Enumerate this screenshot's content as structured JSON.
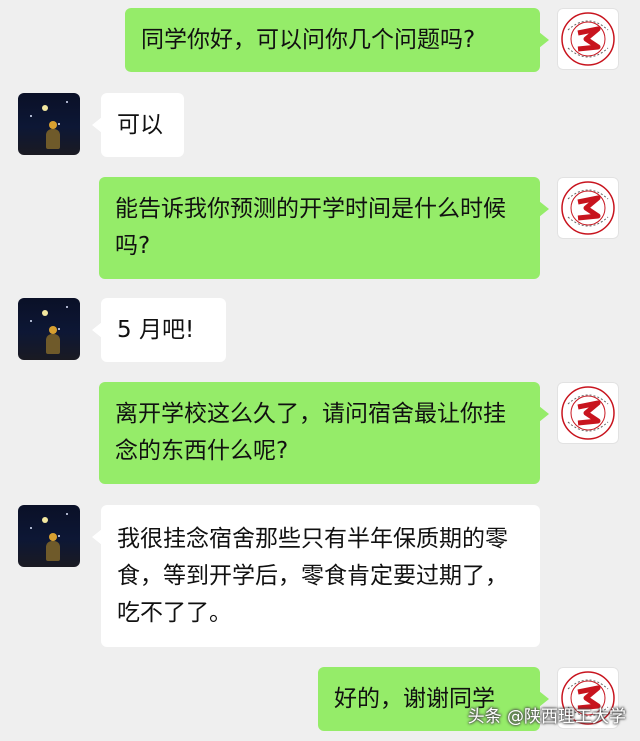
{
  "messages": [
    {
      "sender": "me",
      "text": "同学你好，可以问你几个问题吗?"
    },
    {
      "sender": "other",
      "text": "可以"
    },
    {
      "sender": "me",
      "text": "能告诉我你预测的开学时间是什么时候吗?"
    },
    {
      "sender": "other",
      "text": "5 月吧!"
    },
    {
      "sender": "me",
      "text": "离开学校这么久了，请问宿舍最让你挂念的东西什么呢?"
    },
    {
      "sender": "other",
      "text": "我很挂念宿舍那些只有半年保质期的零食，等到开学后，零食肯定要过期了，吃不了了。"
    },
    {
      "sender": "me",
      "text": "好的，谢谢同学"
    }
  ],
  "watermark": "头条 @陕西理工大学",
  "colors": {
    "background": "#efefef",
    "bubble_me": "#95ec69",
    "bubble_other": "#ffffff",
    "logo_red": "#c8141e"
  },
  "icons": {
    "avatar_me": "university-emblem-icon",
    "avatar_other": "night-sky-avatar-icon"
  }
}
